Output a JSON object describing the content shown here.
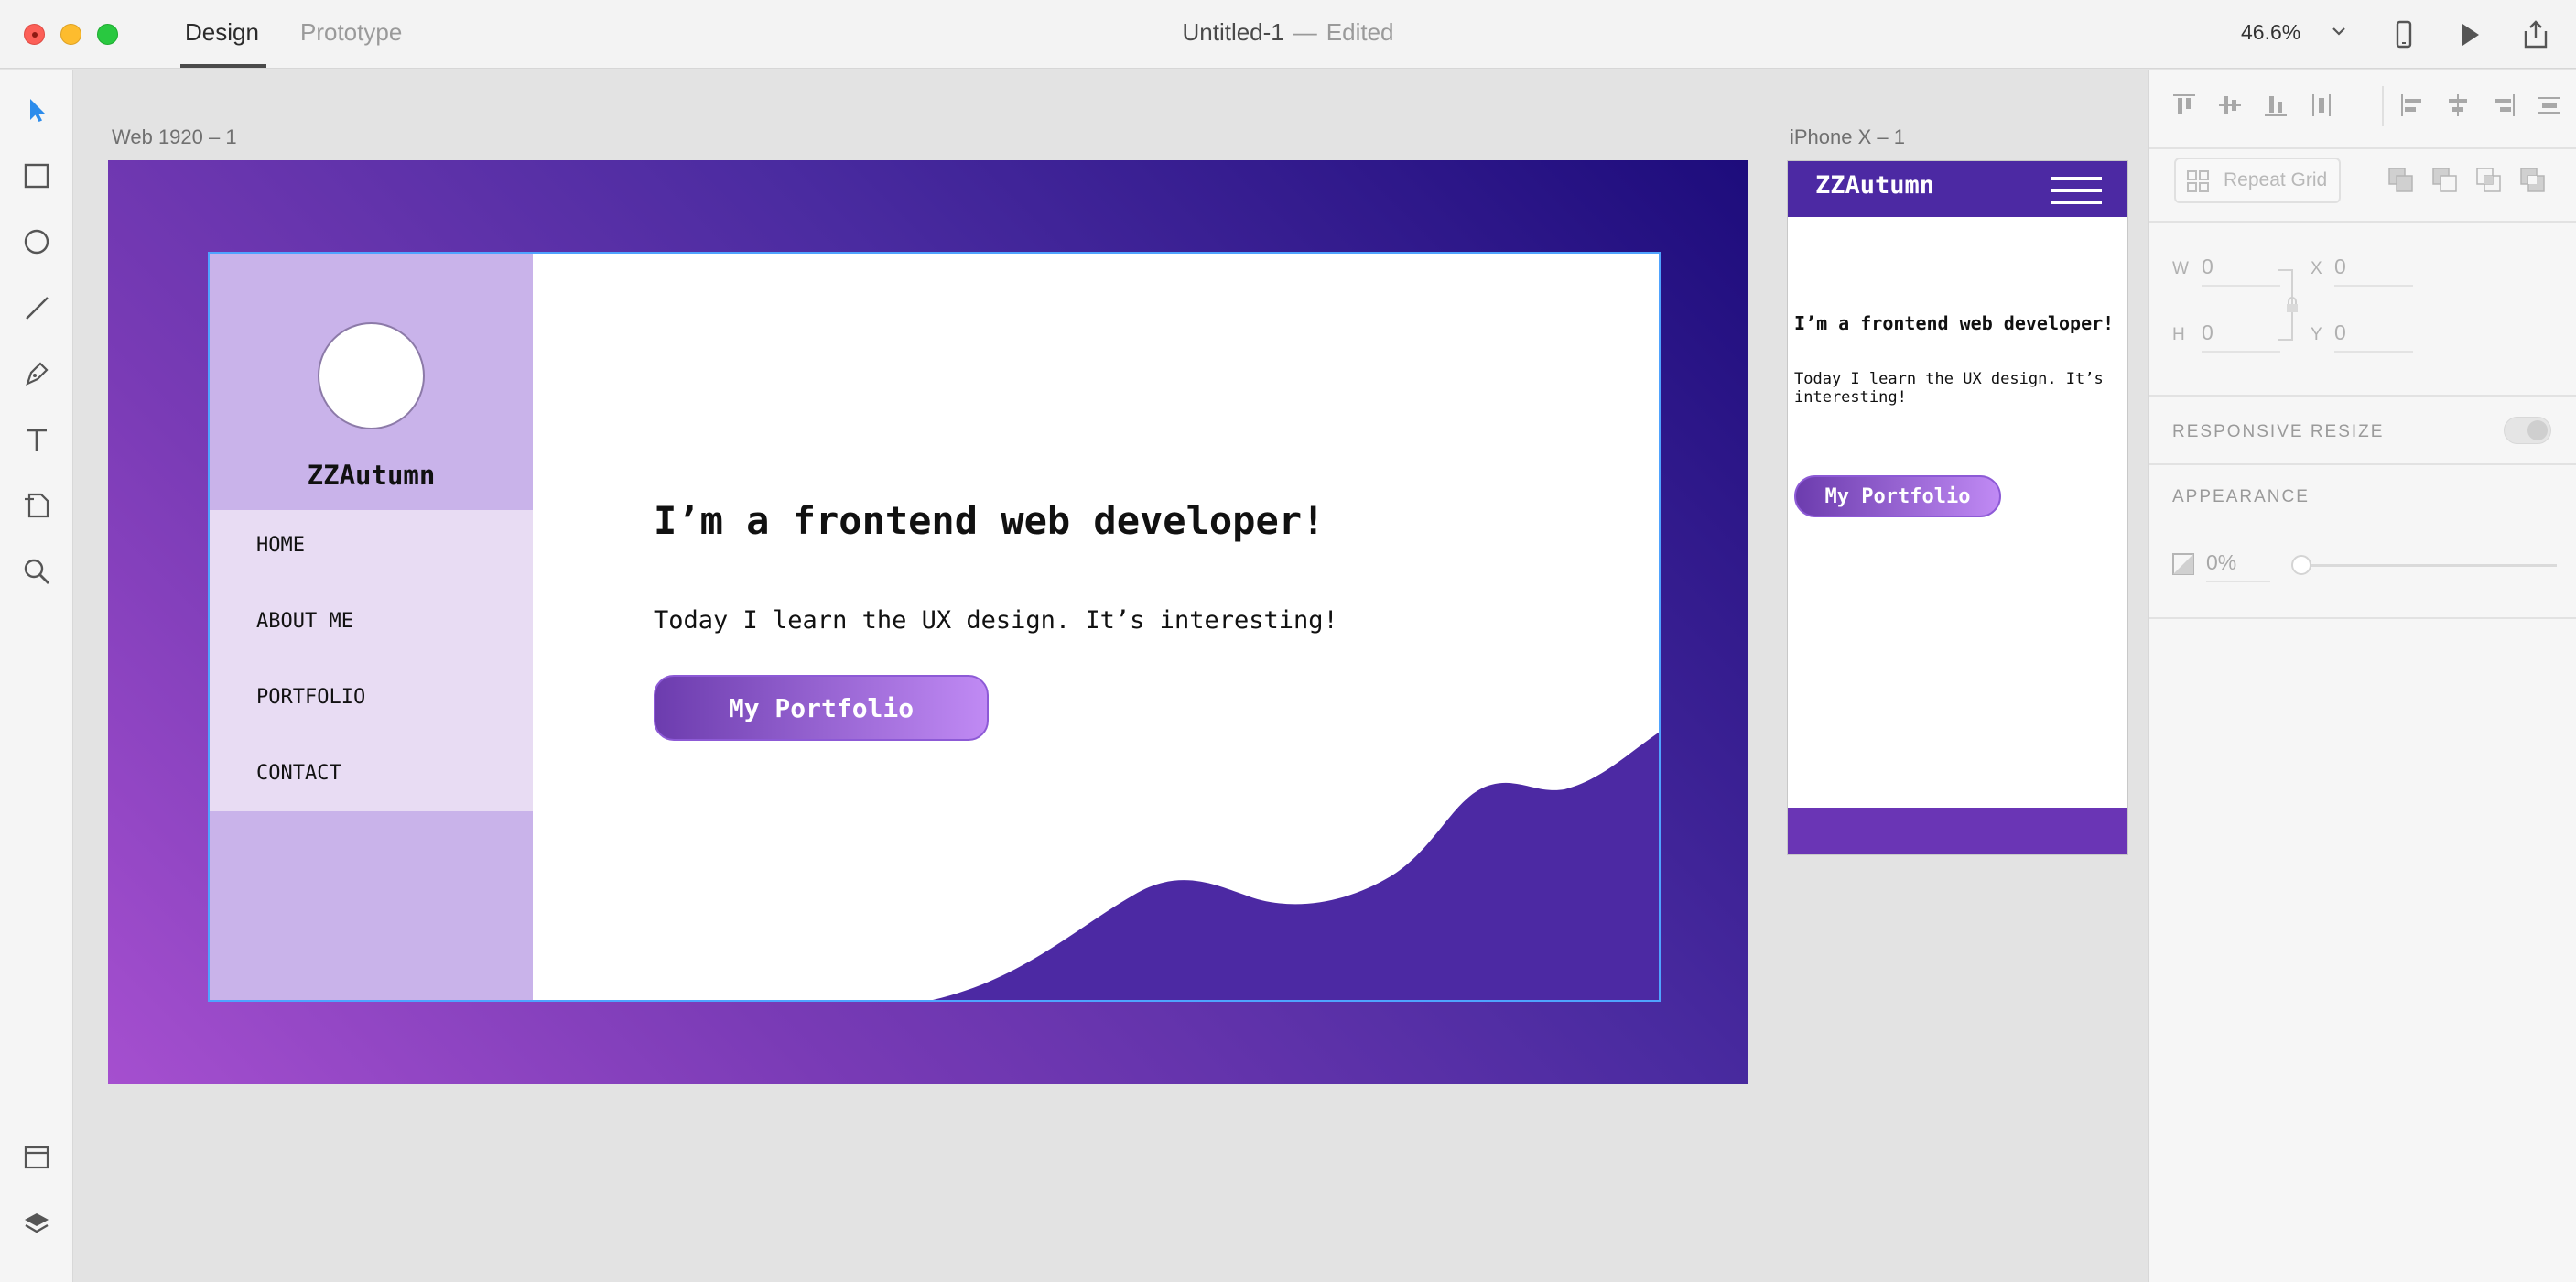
{
  "titlebar": {
    "tabs": [
      {
        "label": "Design",
        "active": true
      },
      {
        "label": "Prototype",
        "active": false
      }
    ],
    "document_name": "Untitled-1",
    "separator": "—",
    "status": "Edited",
    "zoom": "46.6%",
    "icons": [
      "device-preview-icon",
      "play-icon",
      "share-icon"
    ]
  },
  "tools": [
    "select-tool",
    "rectangle-tool",
    "ellipse-tool",
    "line-tool",
    "pen-tool",
    "text-tool",
    "artboard-tool",
    "zoom-tool",
    "assets-panel",
    "layers-panel"
  ],
  "canvas": {
    "web_artboard": {
      "label": "Web 1920 – 1",
      "site_name": "ZZAutumn",
      "nav": [
        "HOME",
        "ABOUT ME",
        "PORTFOLIO",
        "CONTACT"
      ],
      "heading": "I’m a frontend web developer!",
      "text": "Today I learn the UX design. It’s interesting!",
      "button": "My Portfolio",
      "colors": {
        "sidebar": "#c9b3ea",
        "nav": "#e8dcf3",
        "wave": "#4c29a3",
        "gradient_start": "#a54fcf",
        "gradient_end": "#1d0c7c"
      }
    },
    "phone_artboard": {
      "label": "iPhone X – 1",
      "site_name": "ZZAutumn",
      "heading": "I’m a frontend web developer!",
      "text": "Today I learn the UX design. It’s interesting!",
      "button": "My Portfolio",
      "colors": {
        "header": "#4c29a3",
        "footer": "#6a35b5"
      }
    }
  },
  "inspector": {
    "repeat_grid": "Repeat Grid",
    "w_label": "W",
    "w_value": "0",
    "h_label": "H",
    "h_value": "0",
    "x_label": "X",
    "x_value": "0",
    "y_label": "Y",
    "y_value": "0",
    "responsive_resize": "RESPONSIVE RESIZE",
    "appearance": "APPEARANCE",
    "opacity": "0%"
  }
}
